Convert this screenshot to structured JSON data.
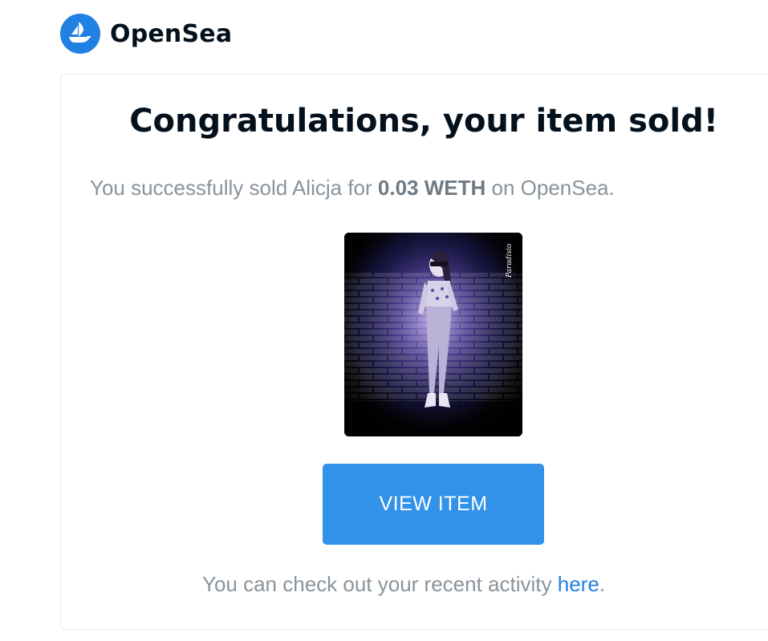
{
  "brand": {
    "name": "OpenSea",
    "icon": "opensea-boat-icon",
    "color": "#2081e2"
  },
  "email": {
    "title": "Congratulations, your item sold!",
    "message": {
      "prefix": "You successfully sold ",
      "item_name": "Alicja",
      "middle": " for ",
      "price": "0.03 WETH",
      "suffix": " on OpenSea."
    },
    "artwork": {
      "signature": "Paradisio"
    },
    "button_label": "VIEW ITEM",
    "button_color": "#3291e9",
    "footer": {
      "prefix": "You can check out your recent activity ",
      "link_text": "here",
      "suffix": "."
    }
  }
}
